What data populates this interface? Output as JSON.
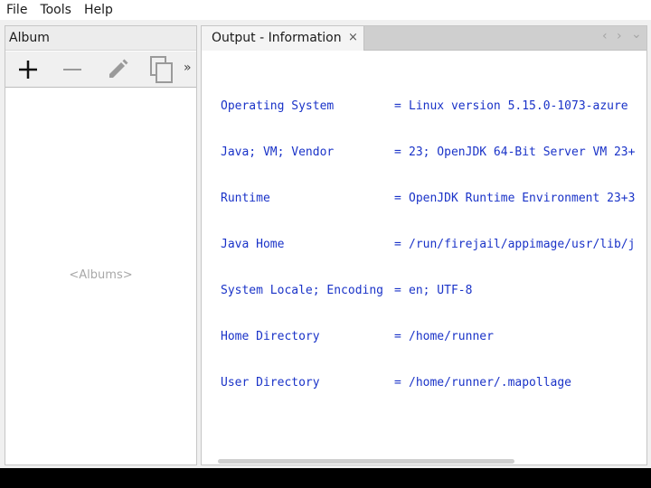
{
  "menubar": {
    "items": [
      {
        "label": "File"
      },
      {
        "label": "Tools"
      },
      {
        "label": "Help"
      }
    ]
  },
  "album": {
    "title": "Album",
    "toolbar": {
      "add_icon": "plus-icon",
      "remove_icon": "minus-icon",
      "edit_icon": "pencil-icon",
      "copy_icon": "copy-icon",
      "overflow": "»"
    },
    "placeholder": "<Albums>"
  },
  "output": {
    "tab_label": "Output - Information",
    "tab_close": "×",
    "nav_prev": "‹",
    "nav_next": "›",
    "nav_menu": "⌄",
    "lines": [
      {
        "key": "Operating System",
        "value": "Linux version 5.15.0-1073-azure"
      },
      {
        "key": "Java; VM; Vendor",
        "value": "23; OpenJDK 64-Bit Server VM 23+"
      },
      {
        "key": "Runtime",
        "value": "OpenJDK Runtime Environment 23+3"
      },
      {
        "key": "Java Home",
        "value": "/run/firejail/appimage/usr/lib/j"
      },
      {
        "key": "System Locale; Encoding",
        "value": "en; UTF-8"
      },
      {
        "key": "Home Directory",
        "value": "/home/runner"
      },
      {
        "key": "User Directory",
        "value": "/home/runner/.mapollage"
      }
    ],
    "equals": "="
  },
  "colors": {
    "console_text": "#1a33c8",
    "placeholder_text": "#a8a8a8",
    "tab_strip": "#cfcfcf"
  }
}
